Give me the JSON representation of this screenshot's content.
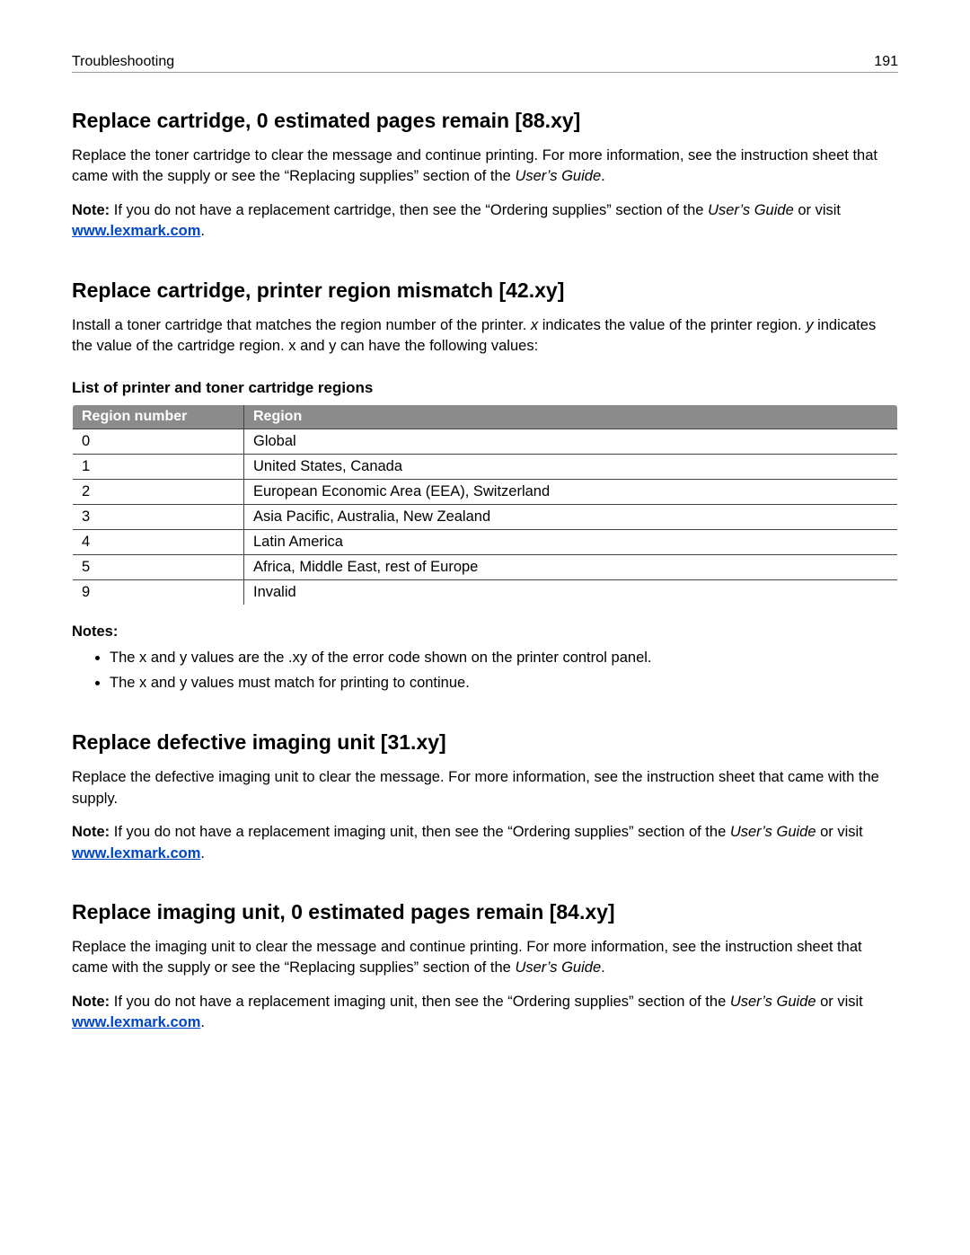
{
  "header": {
    "section": "Troubleshooting",
    "page": "191"
  },
  "s1": {
    "title": "Replace cartridge, 0 estimated pages remain [88.xy]",
    "p1a": "Replace the toner cartridge to clear the message and continue printing. For more information, see the instruction sheet that came with the supply or see the “Replacing supplies” section of the ",
    "p1b": "User’s Guide",
    "p1c": ".",
    "note_label": "Note:",
    "note_a": " If you do not have a replacement cartridge, then see the “Ordering supplies” section of the ",
    "note_b": "User’s Guide",
    "note_c": " or visit ",
    "link": "www.lexmark.com",
    "note_d": "."
  },
  "s2": {
    "title": "Replace cartridge, printer region mismatch [42.xy]",
    "p1a": "Install a toner cartridge that matches the region number of the printer. ",
    "p1b": "x",
    "p1c": " indicates the value of the printer region. ",
    "p1d": "y",
    "p1e": " indicates the value of the cartridge region. x and y can have the following values:",
    "table_caption": "List of printer and toner cartridge regions",
    "th1": "Region number",
    "th2": "Region",
    "rows": [
      {
        "num": "0",
        "region": "Global"
      },
      {
        "num": "1",
        "region": "United States, Canada"
      },
      {
        "num": "2",
        "region": "European Economic Area (EEA), Switzerland"
      },
      {
        "num": "3",
        "region": "Asia Pacific, Australia, New Zealand"
      },
      {
        "num": "4",
        "region": "Latin America"
      },
      {
        "num": "5",
        "region": "Africa, Middle East, rest of Europe"
      },
      {
        "num": "9",
        "region": "Invalid"
      }
    ],
    "notes_label": "Notes:",
    "notes": [
      "The x and y values are the .xy of the error code shown on the printer control panel.",
      "The x and y values must match for printing to continue."
    ]
  },
  "s3": {
    "title": "Replace defective imaging unit [31.xy]",
    "p1": "Replace the defective imaging unit to clear the message. For more information, see the instruction sheet that came with the supply.",
    "note_label": "Note:",
    "note_a": " If you do not have a replacement imaging unit, then see the “Ordering supplies” section of the ",
    "note_b": "User’s Guide",
    "note_c": " or visit ",
    "link": "www.lexmark.com",
    "note_d": "."
  },
  "s4": {
    "title": "Replace imaging unit, 0 estimated pages remain [84.xy]",
    "p1a": "Replace the imaging unit to clear the message and continue printing. For more information, see the instruction sheet that came with the supply or see the “Replacing supplies” section of the ",
    "p1b": "User’s Guide",
    "p1c": ".",
    "note_label": "Note:",
    "note_a": " If you do not have a replacement imaging unit, then see the “Ordering supplies” section of the ",
    "note_b": "User’s Guide",
    "note_c": " or visit ",
    "link": "www.lexmark.com",
    "note_d": "."
  }
}
